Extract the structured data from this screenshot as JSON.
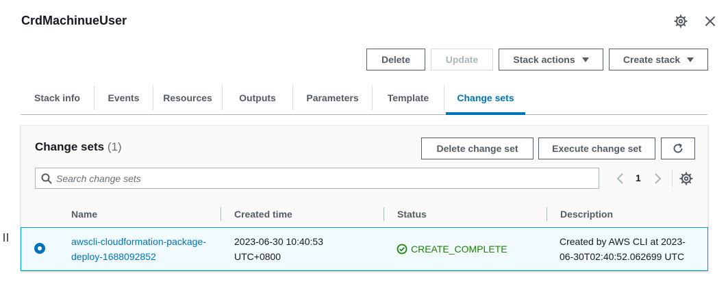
{
  "header": {
    "title": "CrdMachinueUser",
    "settings_icon": "gear-icon",
    "close_icon": "close-icon"
  },
  "actions": {
    "delete": "Delete",
    "update": "Update",
    "stack_actions": "Stack actions",
    "create_stack": "Create stack"
  },
  "tabs": [
    {
      "label": "Stack info"
    },
    {
      "label": "Events"
    },
    {
      "label": "Resources"
    },
    {
      "label": "Outputs"
    },
    {
      "label": "Parameters"
    },
    {
      "label": "Template"
    },
    {
      "label": "Change sets"
    }
  ],
  "active_tab": "Change sets",
  "change_sets": {
    "title": "Change sets",
    "count": "(1)",
    "delete_button": "Delete change set",
    "execute_button": "Execute change set",
    "refresh_icon": "refresh-icon",
    "search_placeholder": "Search change sets",
    "search_value": "",
    "page": "1",
    "columns": [
      "Name",
      "Created time",
      "Status",
      "Description"
    ],
    "rows": [
      {
        "selected": true,
        "name": "awscli-cloudformation-package-deploy-1688092852",
        "created_time": "2023-06-30 10:40:53 UTC+0800",
        "status": "CREATE_COMPLETE",
        "description": "Created by AWS CLI at 2023-06-30T02:40:52.062699 UTC"
      }
    ]
  },
  "colors": {
    "accent": "#0073bb",
    "success": "#1d8102",
    "selected_row_bg": "#f1faff",
    "selected_row_border": "#00a1c9"
  }
}
